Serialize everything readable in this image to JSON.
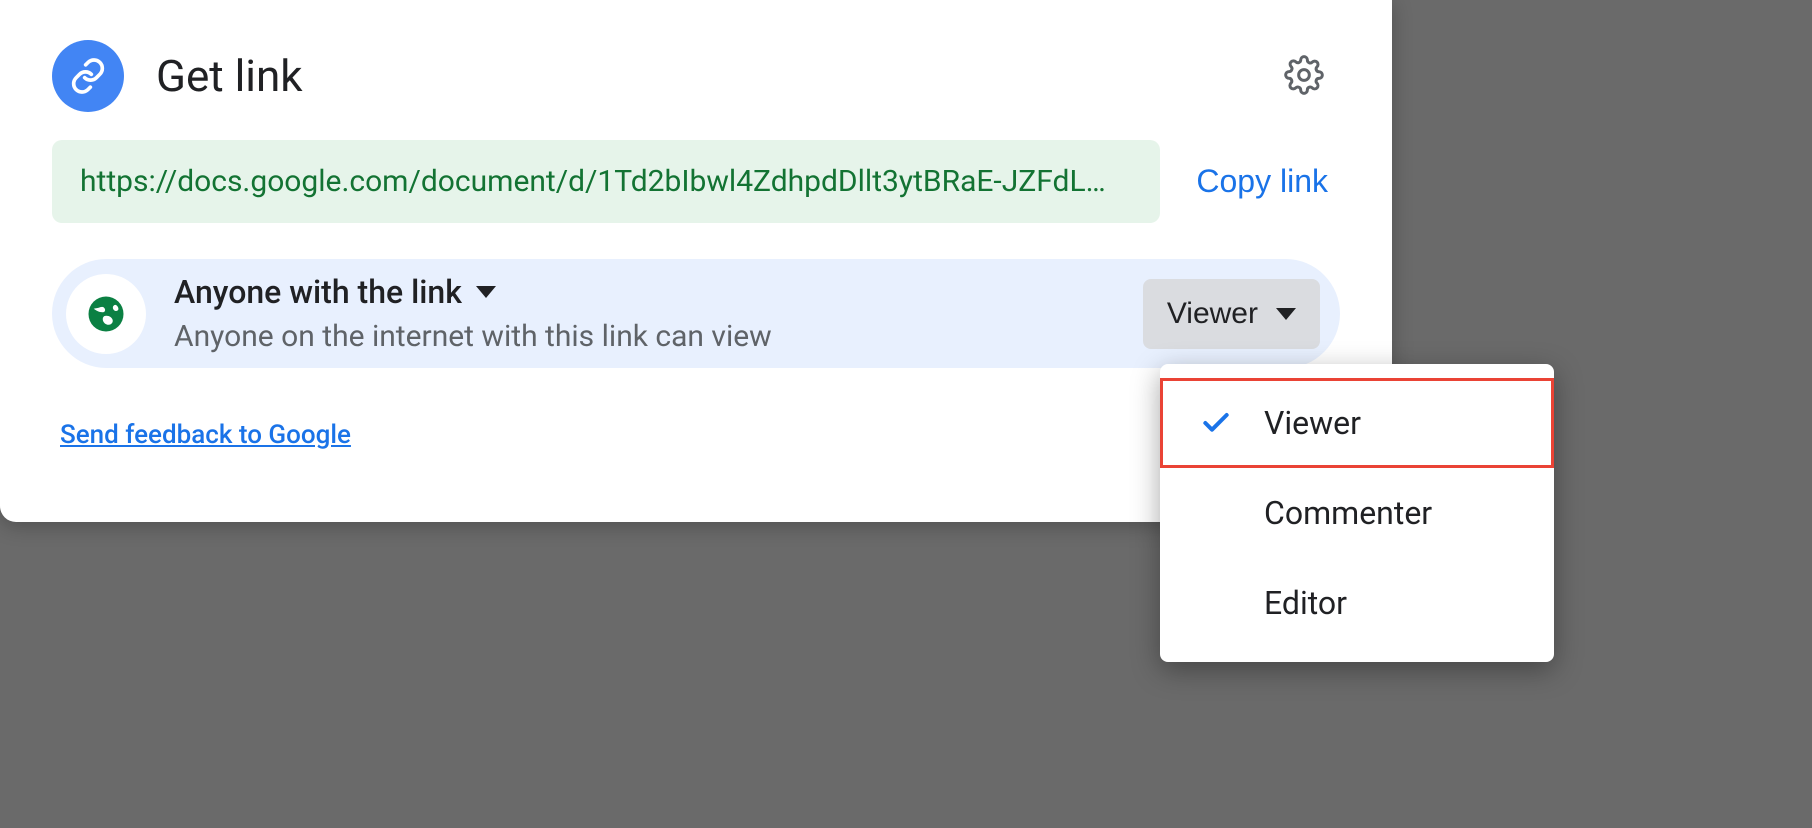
{
  "header": {
    "title": "Get link"
  },
  "link": {
    "url": "https://docs.google.com/document/d/1Td2bIbwl4ZdhpdDllt3ytBRaE-JZFdL…",
    "copy_label": "Copy link"
  },
  "access": {
    "scope_label": "Anyone with the link",
    "scope_description": "Anyone on the internet with this link can view",
    "role_button_label": "Viewer"
  },
  "feedback": {
    "label": "Send feedback to Google"
  },
  "role_menu": {
    "options": [
      {
        "label": "Viewer",
        "selected": true
      },
      {
        "label": "Commenter",
        "selected": false
      },
      {
        "label": "Editor",
        "selected": false
      }
    ]
  }
}
